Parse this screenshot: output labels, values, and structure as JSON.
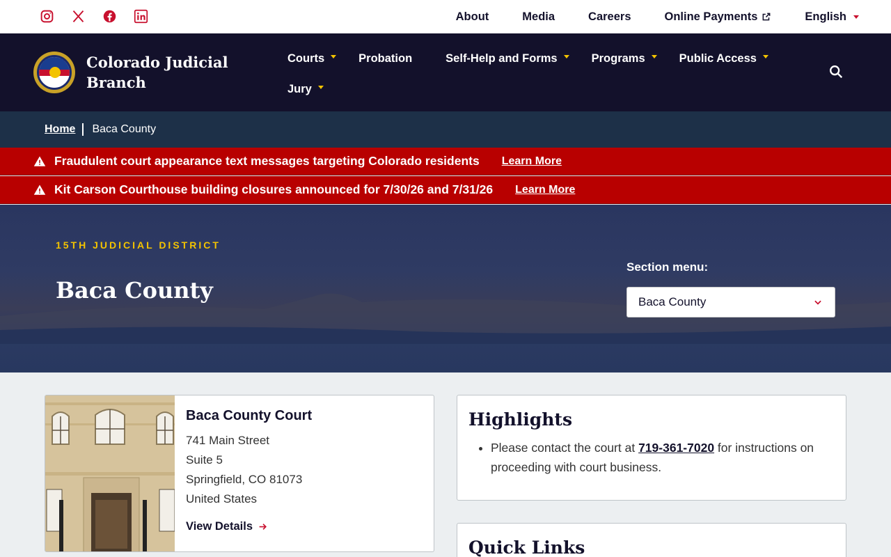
{
  "utility": {
    "social": [
      {
        "name": "instagram-icon"
      },
      {
        "name": "x-icon"
      },
      {
        "name": "facebook-icon"
      },
      {
        "name": "linkedin-icon"
      }
    ],
    "links": {
      "about": "About",
      "media": "Media",
      "careers": "Careers",
      "payments": "Online Payments",
      "language": "English"
    }
  },
  "header": {
    "brand": "Colorado Judicial Branch",
    "nav": {
      "courts": "Courts",
      "probation": "Probation",
      "selfhelp": "Self-Help and Forms",
      "programs": "Programs",
      "public_access": "Public Access",
      "jury": "Jury"
    }
  },
  "breadcrumb": {
    "home": "Home",
    "current": "Baca County"
  },
  "alerts": [
    {
      "message": "Fraudulent court appearance text messages targeting Colorado residents",
      "link": "Learn More"
    },
    {
      "message": "Kit Carson Courthouse building closures announced for 7/30/26 and 7/31/26",
      "link": "Learn More"
    }
  ],
  "hero": {
    "district": "15TH JUDICIAL DISTRICT",
    "title": "Baca County",
    "section_menu_label": "Section menu:",
    "section_menu_value": "Baca County"
  },
  "court": {
    "name": "Baca County Court",
    "address_1": "741 Main Street",
    "address_2": "Suite 5",
    "city_line": "Springfield, CO 81073",
    "country": "United States",
    "view_details": "View Details"
  },
  "highlights": {
    "title": "Highlights",
    "text_before": "Please contact the court at ",
    "phone": "719-361-7020",
    "text_after": " for instructions on proceeding with court business."
  },
  "quick_links": {
    "title": "Quick Links"
  },
  "colors": {
    "navy": "#13112b",
    "alert_red": "#b80000",
    "gold": "#f3c300",
    "brand_red": "#c8102e"
  }
}
